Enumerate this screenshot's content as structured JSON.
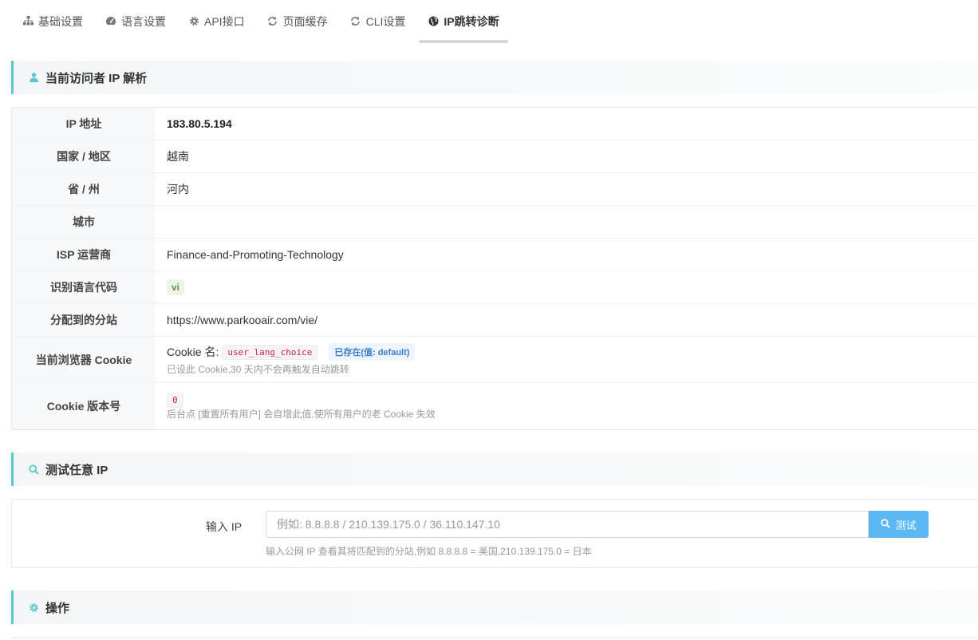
{
  "tabs": [
    {
      "label": "基础设置",
      "icon": "sitemap-icon"
    },
    {
      "label": "语言设置",
      "icon": "dashboard-icon"
    },
    {
      "label": "API接口",
      "icon": "gear-icon"
    },
    {
      "label": "页面缓存",
      "icon": "refresh-icon"
    },
    {
      "label": "CLI设置",
      "icon": "refresh-icon"
    },
    {
      "label": "IP跳转诊断",
      "icon": "globe-icon"
    }
  ],
  "active_tab": 5,
  "accent_color": "#5bc7cc",
  "section_visitor": {
    "title": "当前访问者 IP 解析"
  },
  "info": {
    "ip": {
      "label": "IP 地址",
      "value": "183.80.5.194"
    },
    "country": {
      "label": "国家 / 地区",
      "value": "越南"
    },
    "province": {
      "label": "省 / 州",
      "value": "河内"
    },
    "city": {
      "label": "城市",
      "value": ""
    },
    "isp": {
      "label": "ISP 运营商",
      "value": "Finance-and-Promoting-Technology"
    },
    "lang_code": {
      "label": "识别语言代码",
      "value": "vi"
    },
    "site": {
      "label": "分配到的分站",
      "value": "https://www.parkooair.com/vie/"
    },
    "cookie": {
      "label": "当前浏览器 Cookie",
      "prefix": "Cookie 名:",
      "name": "user_lang_choice",
      "status": "已存在(值: default)",
      "hint": "已设此 Cookie,30 天内不会再触发自动跳转"
    },
    "cookie_version": {
      "label": "Cookie 版本号",
      "value": "0",
      "hint": "后台点 [重置所有用户] 会自增此值,使所有用户的老 Cookie 失效"
    }
  },
  "section_test": {
    "title": "测试任意 IP"
  },
  "test": {
    "label": "输入 IP",
    "placeholder": "例如: 8.8.8.8 / 210.139.175.0 / 36.110.147.10",
    "button": "测试",
    "hint": "输入公网 IP 查看其将匹配到的分站,例如 8.8.8.8 = 美国,210.139.175.0 = 日本"
  },
  "section_ops": {
    "title": "操作"
  }
}
